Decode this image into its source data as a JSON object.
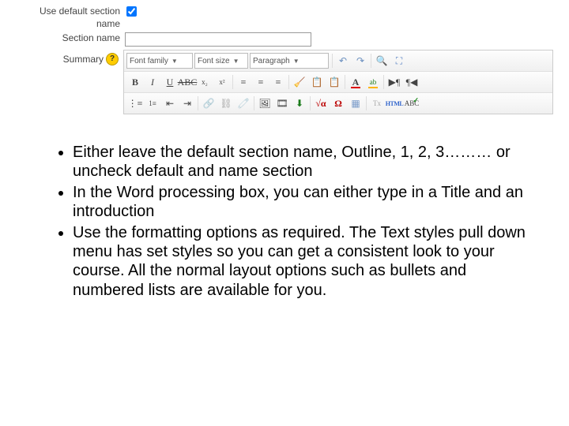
{
  "form": {
    "use_default_label": "Use default section name",
    "use_default_checked": true,
    "section_name_label": "Section name",
    "section_name_value": "",
    "summary_label": "Summary"
  },
  "editor": {
    "font_family": "Font family",
    "font_size": "Font size",
    "paragraph": "Paragraph",
    "html_label": "HTML"
  },
  "bullets": {
    "b1": "Either leave the default section name, Outline, 1, 2, 3……… or uncheck default and name section",
    "b2": "In the Word processing box, you can either type in a Title and an introduction",
    "b3": "Use the formatting options as required. The Text styles pull down menu has set styles so you can get a consistent look to your course. All the normal layout options such as bullets and numbered lists are available for you."
  }
}
